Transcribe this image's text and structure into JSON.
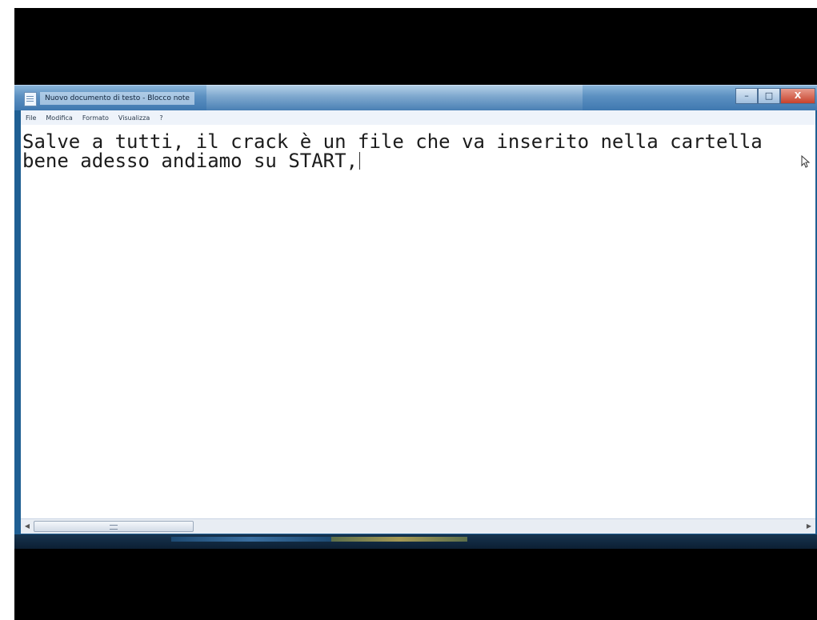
{
  "window": {
    "title": "Nuovo documento di testo - Blocco note",
    "controls": {
      "minimize": "–",
      "maximize": "□",
      "close": "X"
    }
  },
  "menubar": {
    "items": [
      "File",
      "Modifica",
      "Formato",
      "Visualizza",
      "?"
    ]
  },
  "editor": {
    "line1": "Salve a tutti, il crack è un file che va inserito nella cartella",
    "line2": "bene adesso andiamo su START,"
  },
  "colors": {
    "titlebar": "#5b90c1",
    "frame": "#000000",
    "editor_bg": "#ffffff"
  },
  "icons": [
    "notepad-icon",
    "mouse-pointer-icon",
    "grip-icon"
  ]
}
